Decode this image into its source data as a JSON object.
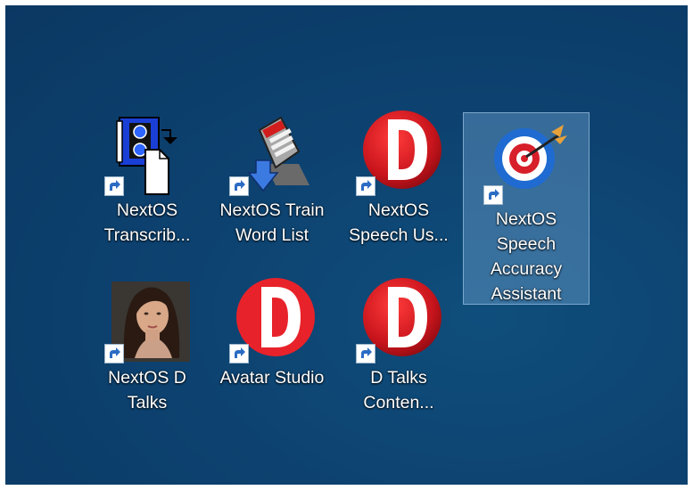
{
  "desktop": {
    "background_color": "#0d4270",
    "icons": [
      {
        "label": "NextOS\nTranscrib...",
        "icon": "transcriber-app-icon",
        "shortcut": true,
        "selected": false
      },
      {
        "label": "NextOS Train\nWord List",
        "icon": "word-list-app-icon",
        "shortcut": true,
        "selected": false
      },
      {
        "label": "NextOS\nSpeech Us...",
        "icon": "red-d-logo-icon",
        "shortcut": true,
        "selected": false
      },
      {
        "label": "NextOS\nSpeech\nAccuracy\nAssistant",
        "icon": "target-bullseye-icon",
        "shortcut": true,
        "selected": true
      },
      {
        "label": "NextOS D\nTalks",
        "icon": "avatar-portrait-icon",
        "shortcut": true,
        "selected": false
      },
      {
        "label": "Avatar Studio",
        "icon": "red-d-logo-icon",
        "shortcut": true,
        "selected": false
      },
      {
        "label": "D     Talks\nConten...",
        "icon": "red-d-logo-icon",
        "shortcut": true,
        "selected": false
      }
    ]
  }
}
